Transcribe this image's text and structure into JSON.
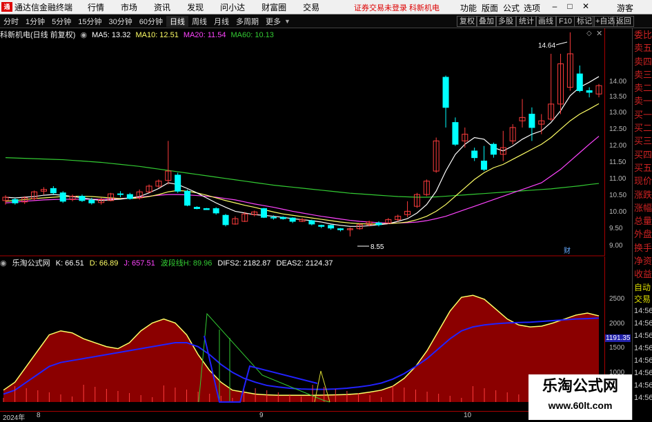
{
  "menubar": {
    "logo": "通",
    "app_title": "通达信金融终端",
    "menus": [
      "行情",
      "市场",
      "资讯",
      "发现",
      "问小达",
      "财富圈",
      "交易"
    ],
    "warning": "证券交易未登录  科新机电",
    "right_menus": [
      "功能",
      "版面",
      "公式",
      "选项"
    ],
    "guest": "游客"
  },
  "toolbar": {
    "periods": [
      "分时",
      "1分钟",
      "5分钟",
      "15分钟",
      "30分钟",
      "60分钟",
      "日线",
      "周线",
      "月线",
      "多周期",
      "更多"
    ],
    "active": "日线",
    "right_buttons": [
      "复权",
      "叠加",
      "多股",
      "统计",
      "画线",
      "F10",
      "标记",
      "+自选",
      "返回"
    ]
  },
  "title": {
    "stock": "科新机电(日线 前复权)",
    "ma5": "MA5: 13.32",
    "ma10": "MA10: 12.51",
    "ma20": "MA20: 11.54",
    "ma60": "MA60: 10.13"
  },
  "annotations": {
    "high": "14.64",
    "low": "8.55",
    "cai": "财",
    "price_tag": "1191.35"
  },
  "indicator": {
    "name": "乐淘公式网",
    "k": "K: 66.51",
    "d": "D: 66.89",
    "j": "J: 657.51",
    "wave": "波段线H: 89.96",
    "difs2": "DIFS2: 2182.87",
    "deas2": "DEAS2: 2124.37"
  },
  "side_panel": [
    "委比",
    "卖五",
    "卖四",
    "卖三",
    "卖二",
    "卖一",
    "买一",
    "买二",
    "买三",
    "买四",
    "买五",
    "现价",
    "涨跌",
    "涨幅",
    "总量",
    "外盘",
    "换手",
    "净资",
    "收益"
  ],
  "side_panel_lower": [
    "自动",
    "交易",
    "14:56",
    "14:56",
    "14:56",
    "14:56",
    "14:56",
    "14:56",
    "14:56",
    "14:56"
  ],
  "price_axis": [
    "14.00",
    "13.50",
    "13.00",
    "12.50",
    "12.00",
    "11.50",
    "11.00",
    "10.50",
    "10.00",
    "9.50",
    "9.00"
  ],
  "ind_axis": [
    "2500",
    "2000",
    "1500",
    "1000"
  ],
  "date_axis": [
    "2024年",
    "8",
    "9",
    "10"
  ],
  "watermark": {
    "line1": "乐淘公式网",
    "line2": "www.60lt.com"
  },
  "colors": {
    "up": "#ff3c3c",
    "down": "#00ffff",
    "ma5": "#ffffff",
    "ma10": "#ffff66",
    "ma20": "#ff44ff",
    "ma60": "#33cc33",
    "fill": "#8b0000",
    "kline": "#ffff66",
    "dline": "#2222ff"
  },
  "chart_data": {
    "type": "candlestick",
    "candles": [
      [
        9.62,
        9.72,
        9.5,
        9.78
      ],
      [
        9.65,
        9.55,
        9.5,
        9.7
      ],
      [
        9.58,
        9.7,
        9.52,
        9.75
      ],
      [
        9.68,
        9.88,
        9.62,
        9.92
      ],
      [
        9.9,
        9.95,
        9.8,
        10.02
      ],
      [
        9.98,
        9.85,
        9.8,
        10.05
      ],
      [
        9.85,
        9.6,
        9.55,
        9.9
      ],
      [
        9.65,
        9.75,
        9.6,
        9.8
      ],
      [
        9.75,
        9.62,
        9.58,
        9.8
      ],
      [
        9.63,
        9.55,
        9.5,
        9.7
      ],
      [
        9.56,
        9.65,
        9.5,
        9.7
      ],
      [
        9.62,
        9.82,
        9.6,
        9.85
      ],
      [
        9.82,
        9.8,
        9.72,
        9.9
      ],
      [
        9.8,
        9.68,
        9.65,
        9.85
      ],
      [
        9.7,
        9.88,
        9.65,
        9.95
      ],
      [
        9.88,
        10.05,
        9.85,
        10.1
      ],
      [
        10.05,
        10.2,
        10,
        10.25
      ],
      [
        10.22,
        10.5,
        10.1,
        11.4
      ],
      [
        10.38,
        9.9,
        9.85,
        10.45
      ],
      [
        9.9,
        9.48,
        9.45,
        9.95
      ],
      [
        9.42,
        9.38,
        9.36,
        9.45
      ],
      [
        9.38,
        9.35,
        9.34,
        9.4
      ],
      [
        9.38,
        9.25,
        9.2,
        9.42
      ],
      [
        9.18,
        8.9,
        8.85,
        9.22
      ],
      [
        8.92,
        9.08,
        8.9,
        9.15
      ],
      [
        9.0,
        9.22,
        8.98,
        9.28
      ],
      [
        9.2,
        9.28,
        9.15,
        9.32
      ],
      [
        9.38,
        9.12,
        9.1,
        9.4
      ],
      [
        9.12,
        9.1,
        9.05,
        9.18
      ],
      [
        9.12,
        9.08,
        9.05,
        9.15
      ],
      [
        9.1,
        9.0,
        8.95,
        9.12
      ],
      [
        9.0,
        9.05,
        8.98,
        9.1
      ],
      [
        9.02,
        8.92,
        8.88,
        9.05
      ],
      [
        8.88,
        8.85,
        8.8,
        8.9
      ],
      [
        8.88,
        8.8,
        8.75,
        8.9
      ],
      [
        8.78,
        8.75,
        8.7,
        8.8
      ],
      [
        8.75,
        8.78,
        8.55,
        8.82
      ],
      [
        8.78,
        8.9,
        8.75,
        8.95
      ],
      [
        8.9,
        8.98,
        8.85,
        9.02
      ],
      [
        8.95,
        8.9,
        8.85,
        9.0
      ],
      [
        8.95,
        9.05,
        8.92,
        9.1
      ],
      [
        9.05,
        9.15,
        9.0,
        9.2
      ],
      [
        9.2,
        9.3,
        9.12,
        9.6
      ],
      [
        9.45,
        9.8,
        9.4,
        9.85
      ],
      [
        9.8,
        10.2,
        9.75,
        10.25
      ],
      [
        10.5,
        11.4,
        10.45,
        11.5
      ],
      [
        13.3,
        12.4,
        11.8,
        13.35
      ],
      [
        11.95,
        11.3,
        11.25,
        12.1
      ],
      [
        11.4,
        11.6,
        11.2,
        11.8
      ],
      [
        11.1,
        10.9,
        10.8,
        11.2
      ],
      [
        10.8,
        10.55,
        10.5,
        11.25
      ],
      [
        11.3,
        11.0,
        10.9,
        11.35
      ],
      [
        11.0,
        11.2,
        10.8,
        11.7
      ],
      [
        11.4,
        11.8,
        11.3,
        11.9
      ],
      [
        12.0,
        12.1,
        11.8,
        12.65
      ],
      [
        12.2,
        11.8,
        11.4,
        12.4
      ],
      [
        11.9,
        12.0,
        11.6,
        12.2
      ],
      [
        12.05,
        12.5,
        12.0,
        14.0
      ],
      [
        12.5,
        13.7,
        12.2,
        14.0
      ],
      [
        13.0,
        14.0,
        12.9,
        14.64
      ],
      [
        13.4,
        12.9,
        12.85,
        13.65
      ],
      [
        12.9,
        12.85,
        12.7,
        13.0
      ],
      [
        12.8,
        13.05,
        12.7,
        13.1
      ]
    ],
    "ma5": [
      9.72,
      9.7,
      9.72,
      9.74,
      9.78,
      9.8,
      9.78,
      9.74,
      9.7,
      9.66,
      9.62,
      9.64,
      9.66,
      9.7,
      9.74,
      9.85,
      9.98,
      10.15,
      10.1,
      9.98,
      9.85,
      9.7,
      9.55,
      9.42,
      9.3,
      9.25,
      9.2,
      9.18,
      9.15,
      9.12,
      9.08,
      9.05,
      9.02,
      8.98,
      8.92,
      8.88,
      8.85,
      8.85,
      8.87,
      8.9,
      8.93,
      9.0,
      9.08,
      9.25,
      9.5,
      9.9,
      10.5,
      11.0,
      11.3,
      11.5,
      11.45,
      11.2,
      11.1,
      11.25,
      11.45,
      11.6,
      11.7,
      11.95,
      12.3,
      12.75,
      13.0,
      13.15,
      13.32
    ],
    "ma10": [
      9.6,
      9.62,
      9.65,
      9.68,
      9.7,
      9.72,
      9.74,
      9.75,
      9.75,
      9.74,
      9.72,
      9.7,
      9.68,
      9.68,
      9.7,
      9.74,
      9.8,
      9.88,
      9.92,
      9.9,
      9.85,
      9.78,
      9.7,
      9.62,
      9.55,
      9.48,
      9.42,
      9.35,
      9.28,
      9.22,
      9.18,
      9.14,
      9.1,
      9.06,
      9.02,
      8.98,
      8.95,
      8.93,
      8.92,
      8.92,
      8.93,
      8.95,
      8.98,
      9.05,
      9.15,
      9.3,
      9.5,
      9.75,
      10.0,
      10.25,
      10.45,
      10.6,
      10.7,
      10.85,
      11.0,
      11.15,
      11.3,
      11.5,
      11.75,
      12.0,
      12.2,
      12.35,
      12.51
    ],
    "ma20": [
      9.55,
      9.57,
      9.6,
      9.62,
      9.64,
      9.65,
      9.66,
      9.66,
      9.66,
      9.66,
      9.66,
      9.67,
      9.68,
      9.7,
      9.72,
      9.75,
      9.78,
      9.8,
      9.8,
      9.79,
      9.77,
      9.75,
      9.72,
      9.68,
      9.64,
      9.58,
      9.52,
      9.47,
      9.42,
      9.36,
      9.3,
      9.25,
      9.2,
      9.15,
      9.11,
      9.07,
      9.03,
      9.0,
      8.98,
      8.96,
      8.95,
      8.95,
      8.96,
      8.98,
      9.02,
      9.08,
      9.15,
      9.25,
      9.35,
      9.45,
      9.55,
      9.65,
      9.75,
      9.85,
      9.95,
      10.05,
      10.15,
      10.35,
      10.55,
      10.8,
      11.05,
      11.3,
      11.54
    ],
    "ma60": [
      10.9,
      10.89,
      10.88,
      10.87,
      10.86,
      10.85,
      10.84,
      10.82,
      10.8,
      10.78,
      10.76,
      10.73,
      10.7,
      10.67,
      10.64,
      10.6,
      10.56,
      10.52,
      10.48,
      10.44,
      10.4,
      10.36,
      10.32,
      10.28,
      10.24,
      10.2,
      10.16,
      10.12,
      10.08,
      10.05,
      10.02,
      9.99,
      9.96,
      9.93,
      9.9,
      9.87,
      9.84,
      9.82,
      9.8,
      9.78,
      9.76,
      9.74,
      9.73,
      9.72,
      9.72,
      9.73,
      9.75,
      9.77,
      9.79,
      9.81,
      9.83,
      9.85,
      9.87,
      9.89,
      9.91,
      9.93,
      9.95,
      9.97,
      10.0,
      10.03,
      10.06,
      10.1,
      10.13
    ],
    "kline_ind": [
      300,
      500,
      900,
      1300,
      1700,
      1800,
      1750,
      1600,
      1500,
      1400,
      1350,
      1500,
      1800,
      2000,
      2100,
      2000,
      1700,
      1200,
      800,
      500,
      300,
      250,
      200,
      180,
      170,
      170,
      170,
      170,
      175,
      180,
      190,
      210,
      250,
      300,
      400,
      600,
      900,
      1300,
      1800,
      2300,
      2650,
      2700,
      2600,
      2350,
      2100,
      1950,
      1900,
      1920,
      2000,
      2100,
      2200,
      2250,
      2180
    ],
    "dline_ind": [
      200,
      300,
      500,
      700,
      900,
      1000,
      1050,
      1100,
      1150,
      1200,
      1250,
      1300,
      1350,
      1400,
      1450,
      1500,
      1500,
      1400,
      1200,
      950,
      750,
      600,
      500,
      420,
      380,
      350,
      330,
      320,
      320,
      330,
      350,
      380,
      420,
      480,
      580,
      720,
      900,
      1100,
      1350,
      1600,
      1800,
      1900,
      1950,
      1980,
      2000,
      2010,
      2020,
      2040,
      2060,
      2080,
      2100,
      2110,
      2124
    ]
  }
}
